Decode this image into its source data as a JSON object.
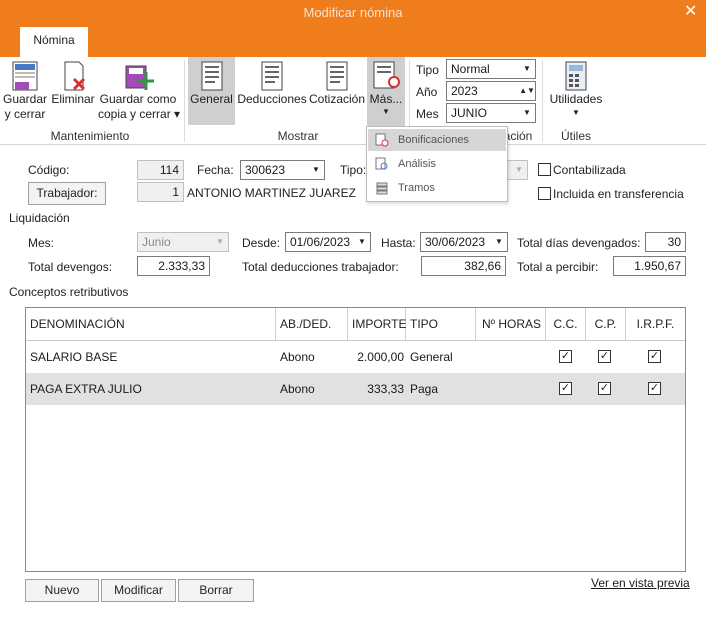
{
  "window": {
    "title": "Modificar nómina",
    "close_glyph": "✕"
  },
  "tab": {
    "label": "Nómina"
  },
  "ribbon": {
    "buttons": {
      "guardar": "Guardar\ny cerrar",
      "eliminar": "Eliminar",
      "guardar_copia": "Guardar como\ncopia y cerrar ▾",
      "general": "General",
      "deducciones": "Deducciones",
      "cotizacion": "Cotización",
      "mas": "Más...",
      "utilidades": "Utilidades"
    },
    "groups": {
      "mantenimiento": "Mantenimiento",
      "mostrar": "Mostrar",
      "liquidacion": "Liquidación",
      "utiles": "Útiles"
    },
    "tipo": {
      "label": "Tipo",
      "value": "Normal"
    },
    "anio": {
      "label": "Año",
      "value": "2023"
    },
    "mes": {
      "label": "Mes",
      "value": "JUNIO"
    }
  },
  "menu": {
    "items": [
      "Bonificaciones",
      "Análisis",
      "Tramos"
    ]
  },
  "form": {
    "codigo_label": "Código:",
    "codigo": "114",
    "fecha_label": "Fecha:",
    "fecha": "300623",
    "tipo_label": "Tipo:",
    "contabilizada": "Contabilizada",
    "trabajador_btn": "Trabajador:",
    "trabajador_id": "1",
    "trabajador_name": "ANTONIO MARTINEZ JUAREZ",
    "incluida": "Incluida en transferencia",
    "liquidacion_label": "Liquidación",
    "mes_label": "Mes:",
    "mes": "Junio",
    "desde_label": "Desde:",
    "desde": "01/06/2023",
    "hasta_label": "Hasta:",
    "hasta": "30/06/2023",
    "total_dias_label": "Total días devengados:",
    "total_dias": "30",
    "total_devengos_label": "Total devengos:",
    "total_devengos": "2.333,33",
    "total_deducciones_label": "Total deducciones trabajador:",
    "total_deducciones": "382,66",
    "total_percibir_label": "Total a percibir:",
    "total_percibir": "1.950,67",
    "conceptos_label": "Conceptos retributivos"
  },
  "table": {
    "headers": [
      "DENOMINACIÓN",
      "AB./DED.",
      "IMPORTE",
      "TIPO",
      "Nº HORAS",
      "C.C.",
      "C.P.",
      "I.R.P.F."
    ],
    "rows": [
      {
        "denominacion": "SALARIO BASE",
        "ab": "Abono",
        "importe": "2.000,00",
        "tipo": "General"
      },
      {
        "denominacion": "PAGA EXTRA JULIO",
        "ab": "Abono",
        "importe": "333,33",
        "tipo": "Paga"
      }
    ],
    "check_glyph": "✓"
  },
  "footer": {
    "nuevo": "Nuevo",
    "modificar": "Modificar",
    "borrar": "Borrar",
    "vista_previa": "Ver en vista previa"
  },
  "colors": {
    "accent": "#f07d1c",
    "selected_row": "#e1e1e1"
  }
}
